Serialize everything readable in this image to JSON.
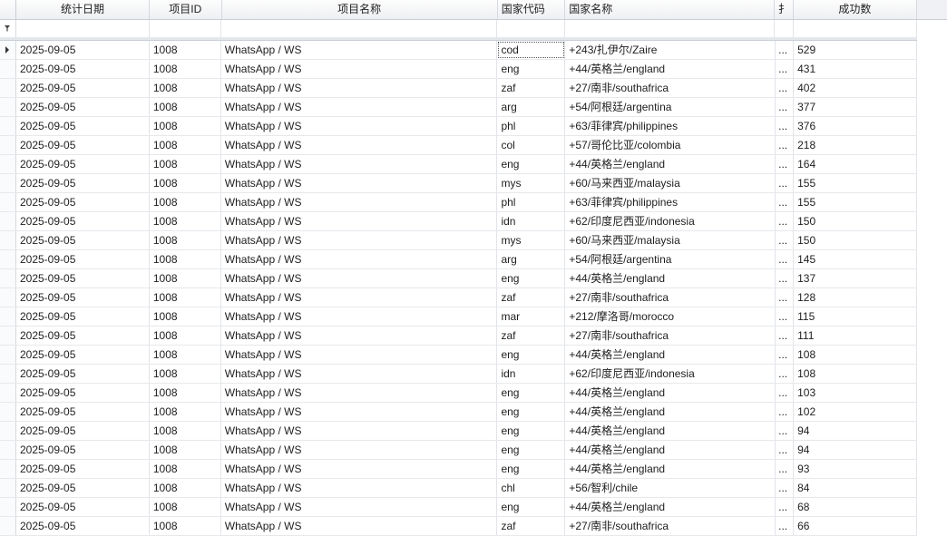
{
  "columns": {
    "date": "统计日期",
    "project_id": "项目ID",
    "project_name": "项目名称",
    "country_code": "国家代码",
    "country_name": "国家名称",
    "truncated": "扌",
    "success_count": "成功数"
  },
  "filter_icon": "filter-icon",
  "current_row_icon": "row-pointer-icon",
  "rows": [
    {
      "date": "2025-09-05",
      "pid": "1008",
      "name": "WhatsApp / WS",
      "cc": "cod",
      "cn": "+243/扎伊尔/Zaire",
      "x": "...",
      "cnt": "529"
    },
    {
      "date": "2025-09-05",
      "pid": "1008",
      "name": "WhatsApp / WS",
      "cc": "eng",
      "cn": "+44/英格兰/england",
      "x": "...",
      "cnt": "431"
    },
    {
      "date": "2025-09-05",
      "pid": "1008",
      "name": "WhatsApp / WS",
      "cc": "zaf",
      "cn": "+27/南非/southafrica",
      "x": "...",
      "cnt": "402"
    },
    {
      "date": "2025-09-05",
      "pid": "1008",
      "name": "WhatsApp / WS",
      "cc": "arg",
      "cn": "+54/阿根廷/argentina",
      "x": "...",
      "cnt": "377"
    },
    {
      "date": "2025-09-05",
      "pid": "1008",
      "name": "WhatsApp / WS",
      "cc": "phl",
      "cn": "+63/菲律宾/philippines",
      "x": "...",
      "cnt": "376"
    },
    {
      "date": "2025-09-05",
      "pid": "1008",
      "name": "WhatsApp / WS",
      "cc": "col",
      "cn": "+57/哥伦比亚/colombia",
      "x": "...",
      "cnt": "218"
    },
    {
      "date": "2025-09-05",
      "pid": "1008",
      "name": "WhatsApp / WS",
      "cc": "eng",
      "cn": "+44/英格兰/england",
      "x": "...",
      "cnt": "164"
    },
    {
      "date": "2025-09-05",
      "pid": "1008",
      "name": "WhatsApp / WS",
      "cc": "mys",
      "cn": "+60/马来西亚/malaysia",
      "x": "...",
      "cnt": "155"
    },
    {
      "date": "2025-09-05",
      "pid": "1008",
      "name": "WhatsApp / WS",
      "cc": "phl",
      "cn": "+63/菲律宾/philippines",
      "x": "...",
      "cnt": "155"
    },
    {
      "date": "2025-09-05",
      "pid": "1008",
      "name": "WhatsApp / WS",
      "cc": "idn",
      "cn": "+62/印度尼西亚/indonesia",
      "x": "...",
      "cnt": "150"
    },
    {
      "date": "2025-09-05",
      "pid": "1008",
      "name": "WhatsApp / WS",
      "cc": "mys",
      "cn": "+60/马来西亚/malaysia",
      "x": "...",
      "cnt": "150"
    },
    {
      "date": "2025-09-05",
      "pid": "1008",
      "name": "WhatsApp / WS",
      "cc": "arg",
      "cn": "+54/阿根廷/argentina",
      "x": "...",
      "cnt": "145"
    },
    {
      "date": "2025-09-05",
      "pid": "1008",
      "name": "WhatsApp / WS",
      "cc": "eng",
      "cn": "+44/英格兰/england",
      "x": "...",
      "cnt": "137"
    },
    {
      "date": "2025-09-05",
      "pid": "1008",
      "name": "WhatsApp / WS",
      "cc": "zaf",
      "cn": "+27/南非/southafrica",
      "x": "...",
      "cnt": "128"
    },
    {
      "date": "2025-09-05",
      "pid": "1008",
      "name": "WhatsApp / WS",
      "cc": "mar",
      "cn": "+212/摩洛哥/morocco",
      "x": "...",
      "cnt": "115"
    },
    {
      "date": "2025-09-05",
      "pid": "1008",
      "name": "WhatsApp / WS",
      "cc": "zaf",
      "cn": "+27/南非/southafrica",
      "x": "...",
      "cnt": "111"
    },
    {
      "date": "2025-09-05",
      "pid": "1008",
      "name": "WhatsApp / WS",
      "cc": "eng",
      "cn": "+44/英格兰/england",
      "x": "...",
      "cnt": "108"
    },
    {
      "date": "2025-09-05",
      "pid": "1008",
      "name": "WhatsApp / WS",
      "cc": "idn",
      "cn": "+62/印度尼西亚/indonesia",
      "x": "...",
      "cnt": "108"
    },
    {
      "date": "2025-09-05",
      "pid": "1008",
      "name": "WhatsApp / WS",
      "cc": "eng",
      "cn": "+44/英格兰/england",
      "x": "...",
      "cnt": "103"
    },
    {
      "date": "2025-09-05",
      "pid": "1008",
      "name": "WhatsApp / WS",
      "cc": "eng",
      "cn": "+44/英格兰/england",
      "x": "...",
      "cnt": "102"
    },
    {
      "date": "2025-09-05",
      "pid": "1008",
      "name": "WhatsApp / WS",
      "cc": "eng",
      "cn": "+44/英格兰/england",
      "x": "...",
      "cnt": "94"
    },
    {
      "date": "2025-09-05",
      "pid": "1008",
      "name": "WhatsApp / WS",
      "cc": "eng",
      "cn": "+44/英格兰/england",
      "x": "...",
      "cnt": "94"
    },
    {
      "date": "2025-09-05",
      "pid": "1008",
      "name": "WhatsApp / WS",
      "cc": "eng",
      "cn": "+44/英格兰/england",
      "x": "...",
      "cnt": "93"
    },
    {
      "date": "2025-09-05",
      "pid": "1008",
      "name": "WhatsApp / WS",
      "cc": "chl",
      "cn": "+56/智利/chile",
      "x": "...",
      "cnt": "84"
    },
    {
      "date": "2025-09-05",
      "pid": "1008",
      "name": "WhatsApp / WS",
      "cc": "eng",
      "cn": "+44/英格兰/england",
      "x": "...",
      "cnt": "68"
    },
    {
      "date": "2025-09-05",
      "pid": "1008",
      "name": "WhatsApp / WS",
      "cc": "zaf",
      "cn": "+27/南非/southafrica",
      "x": "...",
      "cnt": "66"
    }
  ]
}
